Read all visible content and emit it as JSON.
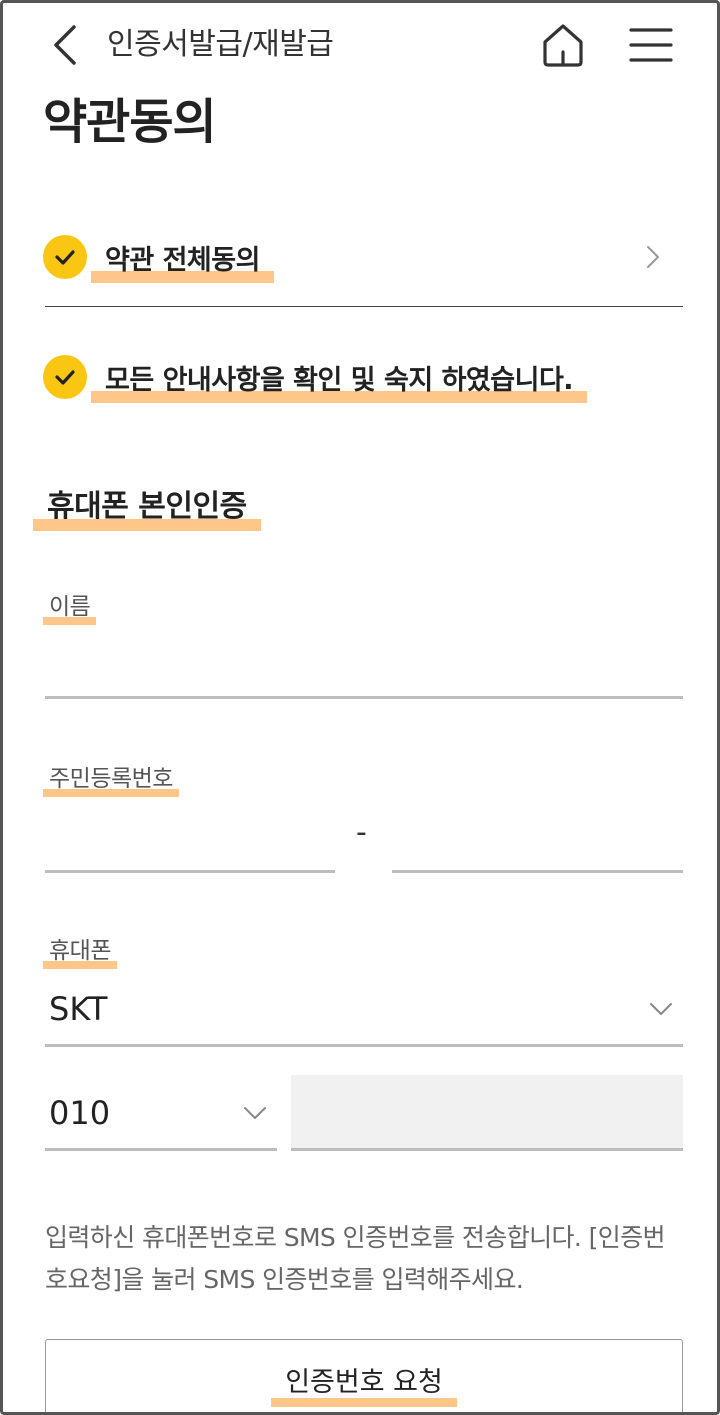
{
  "header": {
    "back_icon": "chevron-left-icon",
    "title": "인증서발급/재발급",
    "home_icon": "home-icon",
    "menu_icon": "hamburger-menu-icon"
  },
  "page_title": "약관동의",
  "agreements": {
    "all": {
      "label": "약관 전체동의",
      "checked": true,
      "arrow_icon": "chevron-right-icon"
    },
    "notice": {
      "label": "모든 안내사항을 확인 및 숙지 하였습니다.",
      "checked": true
    }
  },
  "verification": {
    "section_title": "휴대폰 본인인증",
    "name": {
      "label": "이름",
      "value": "",
      "placeholder": ""
    },
    "rrn": {
      "label": "주민등록번호",
      "front_value": "",
      "separator": "-",
      "back_value": ""
    },
    "phone": {
      "label": "휴대폰",
      "carrier": "SKT",
      "prefix": "010",
      "number_value": ""
    },
    "notice": "입력하신 휴대폰번호로 SMS 인증번호를 전송합니다. [인증번호요청]을 눌러 SMS 인증번호를 입력해주세요.",
    "request_button": "인증번호 요청"
  },
  "colors": {
    "check_yellow": "#f9c613",
    "highlight": "#ffc68a",
    "underline": "#bdbdbd"
  }
}
